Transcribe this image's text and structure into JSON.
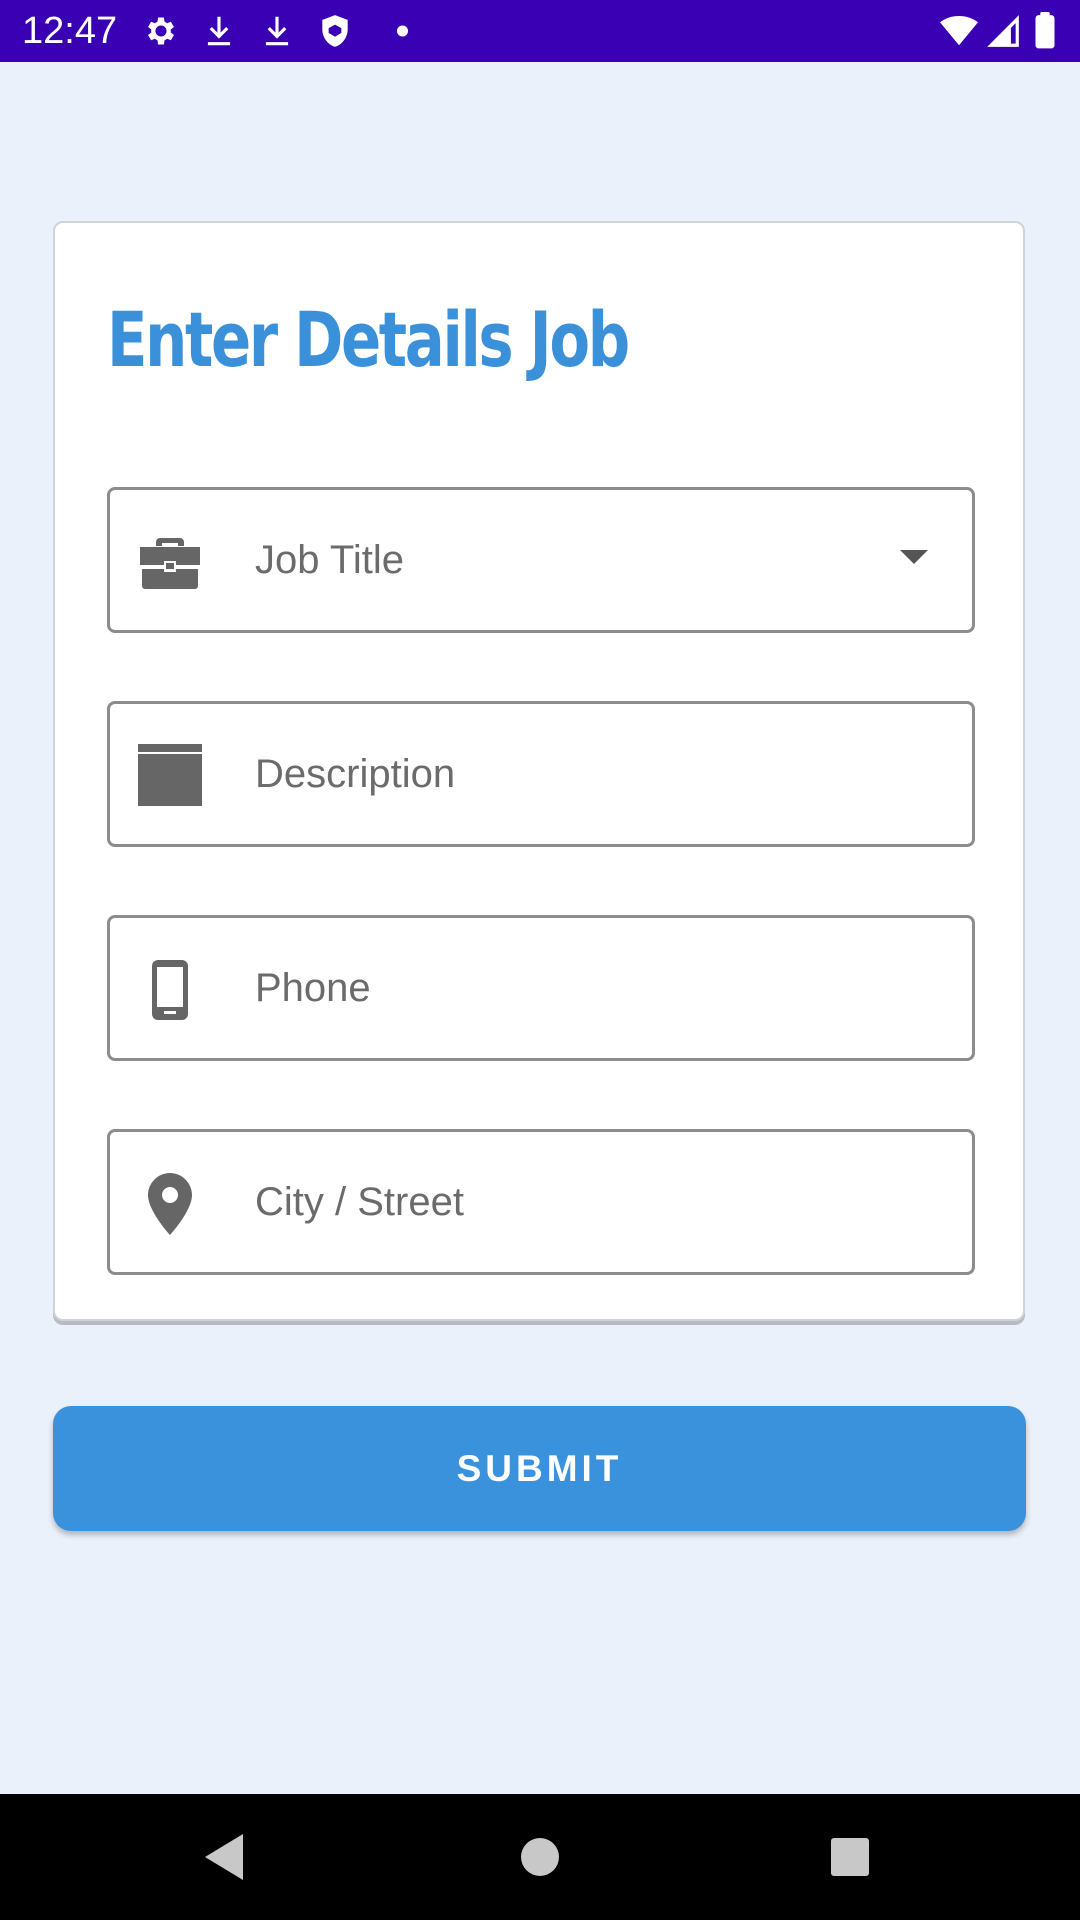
{
  "status_bar": {
    "time": "12:47",
    "left_icons": [
      "gear-icon",
      "download-icon",
      "download-icon",
      "shield-icon",
      "dot-icon"
    ],
    "right_icons": [
      "wifi-icon",
      "cellular-signal-icon",
      "battery-icon"
    ],
    "color": "#3a00b3"
  },
  "form": {
    "title": "Enter Details Job",
    "fields": [
      {
        "placeholder": "Job Title",
        "icon": "briefcase-icon",
        "type": "dropdown"
      },
      {
        "placeholder": "Description",
        "icon": "description-icon",
        "type": "text"
      },
      {
        "placeholder": "Phone",
        "icon": "phone-icon",
        "type": "text"
      },
      {
        "placeholder": "City / Street",
        "icon": "location-pin-icon",
        "type": "text"
      }
    ]
  },
  "submit": {
    "label": "SUBMIT"
  },
  "nav_bar": {
    "buttons": [
      "back-icon",
      "home-icon",
      "recents-icon"
    ]
  },
  "colors": {
    "accent": "#3a91dc",
    "background": "#ebf1fb",
    "status_bar": "#3a00b3"
  }
}
